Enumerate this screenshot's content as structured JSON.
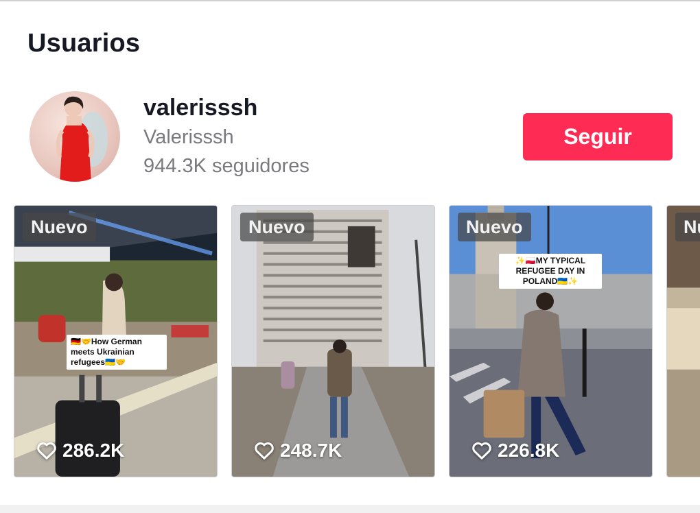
{
  "section": {
    "title": "Usuarios"
  },
  "user": {
    "username": "valerisssh",
    "nickname": "Valerisssh",
    "followers": "944.3K seguidores",
    "follow_label": "Seguir",
    "follow_color": "#fe2c55"
  },
  "videos": [
    {
      "badge": "Nuevo",
      "likes": "286.2K",
      "caption": "🇩🇪🤝How German meets Ukrainian refugees🇺🇦🤝"
    },
    {
      "badge": "Nuevo",
      "likes": "248.7K"
    },
    {
      "badge": "Nuevo",
      "likes": "226.8K",
      "caption": "✨🇵🇱MY TYPICAL REFUGEE DAY IN POLAND🇺🇦✨"
    },
    {
      "badge": "Nu"
    }
  ],
  "icons": {
    "like": "heart-outline-icon"
  }
}
